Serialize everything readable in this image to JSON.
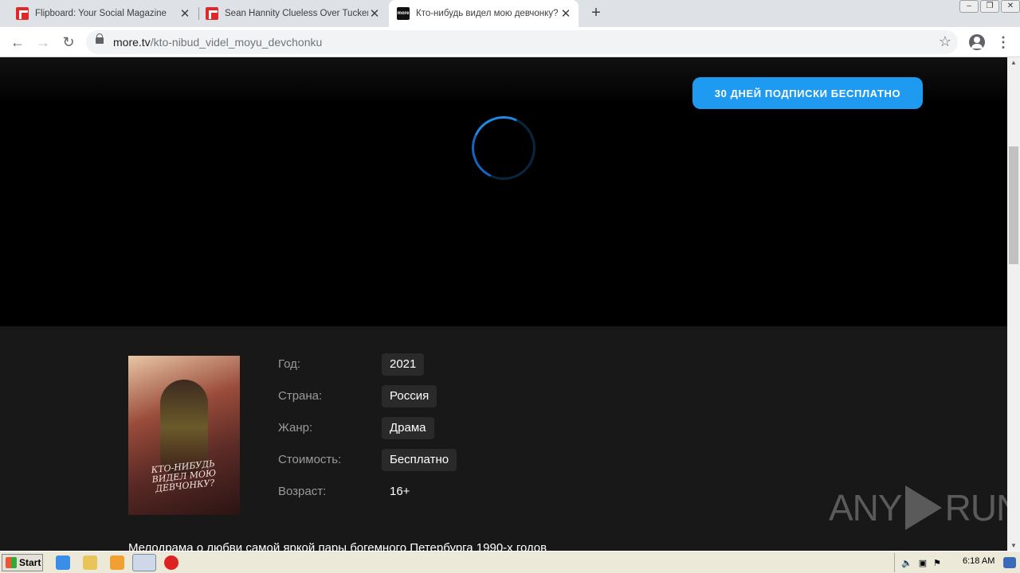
{
  "browser": {
    "tabs": [
      {
        "title": "Flipboard: Your Social Magazine",
        "favicon": "flipboard-icon",
        "active": false
      },
      {
        "title": "Sean Hannity Clueless Over Tucker C",
        "favicon": "flipboard-icon",
        "active": false
      },
      {
        "title": "Кто-нибудь видел мою девчонку?",
        "favicon": "more-tv-icon",
        "active": true
      }
    ],
    "favicon_more_text": "more",
    "url_host": "more.tv",
    "url_path": "/kto-nibud_videl_moyu_devchonku",
    "window_controls": [
      "minimize",
      "restore",
      "close"
    ]
  },
  "page": {
    "subscribe_button": "30 ДНЕЙ ПОДПИСКИ БЕСПЛАТНО",
    "poster_title": "Кто-нибудь видел мою девчонку?",
    "meta": [
      {
        "label": "Год:",
        "value": "2021"
      },
      {
        "label": "Страна:",
        "value": "Россия"
      },
      {
        "label": "Жанр:",
        "value": "Драма"
      },
      {
        "label": "Стоимость:",
        "value": "Бесплатно"
      },
      {
        "label": "Возраст:",
        "value": "16+"
      }
    ],
    "description": "Мелодрама о любви самой яркой пары богемного Петербурга 1990-х годов",
    "watermark_left": "ANY",
    "watermark_right": "RUN",
    "accent_color": "#1e9bf0"
  },
  "taskbar": {
    "start_label": "Start",
    "clock": "6:18 AM"
  }
}
